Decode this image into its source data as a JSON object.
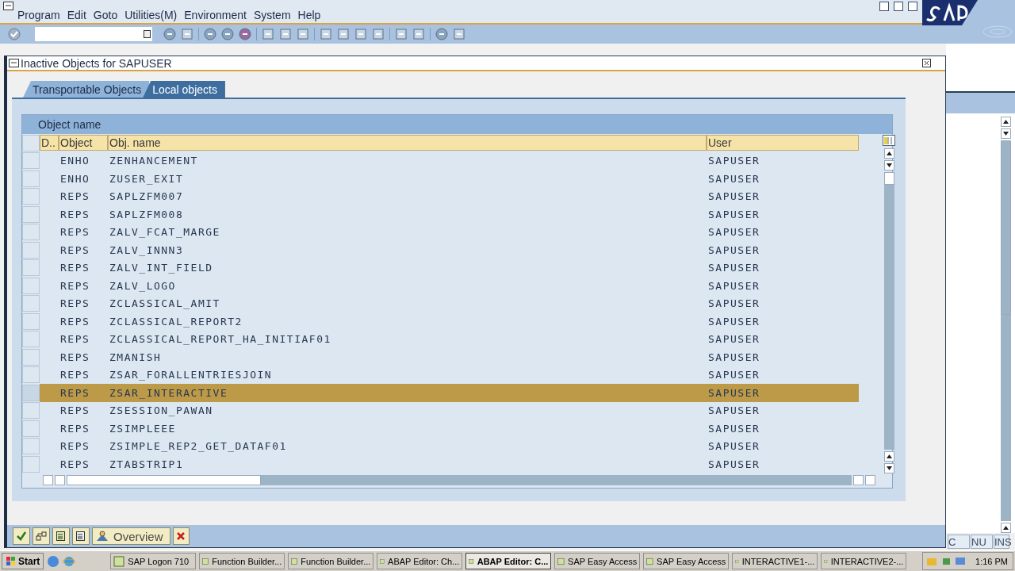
{
  "menu": [
    "Program",
    "Edit",
    "Goto",
    "Utilities(M)",
    "Environment",
    "System",
    "Help"
  ],
  "dialog": {
    "title": "Inactive Objects for SAPUSER",
    "tabs": [
      {
        "label": "Transportable Objects",
        "selected": false
      },
      {
        "label": "Local objects",
        "selected": true
      }
    ],
    "table": {
      "group_header": "Object name",
      "columns": [
        "D..",
        "Object",
        "Obj. name",
        "User"
      ],
      "rows": [
        {
          "object": "ENHO",
          "name": "ZENHANCEMENT",
          "user": "SAPUSER",
          "selected": false
        },
        {
          "object": "ENHO",
          "name": "ZUSER_EXIT",
          "user": "SAPUSER",
          "selected": false
        },
        {
          "object": "REPS",
          "name": "SAPLZFM007",
          "user": "SAPUSER",
          "selected": false
        },
        {
          "object": "REPS",
          "name": "SAPLZFM008",
          "user": "SAPUSER",
          "selected": false
        },
        {
          "object": "REPS",
          "name": "ZALV_FCAT_MARGE",
          "user": "SAPUSER",
          "selected": false
        },
        {
          "object": "REPS",
          "name": "ZALV_INNN3",
          "user": "SAPUSER",
          "selected": false
        },
        {
          "object": "REPS",
          "name": "ZALV_INT_FIELD",
          "user": "SAPUSER",
          "selected": false
        },
        {
          "object": "REPS",
          "name": "ZALV_LOGO",
          "user": "SAPUSER",
          "selected": false
        },
        {
          "object": "REPS",
          "name": "ZCLASSICAL_AMIT",
          "user": "SAPUSER",
          "selected": false
        },
        {
          "object": "REPS",
          "name": "ZCLASSICAL_REPORT2",
          "user": "SAPUSER",
          "selected": false
        },
        {
          "object": "REPS",
          "name": "ZCLASSICAL_REPORT_HA_INITIAF01",
          "user": "SAPUSER",
          "selected": false
        },
        {
          "object": "REPS",
          "name": "ZMANISH",
          "user": "SAPUSER",
          "selected": false
        },
        {
          "object": "REPS",
          "name": "ZSAR_FORALLENTRIESJOIN",
          "user": "SAPUSER",
          "selected": false
        },
        {
          "object": "REPS",
          "name": "ZSAR_INTERACTIVE",
          "user": "SAPUSER",
          "selected": true
        },
        {
          "object": "REPS",
          "name": "ZSESSION_PAWAN",
          "user": "SAPUSER",
          "selected": false
        },
        {
          "object": "REPS",
          "name": "ZSIMPLEEE",
          "user": "SAPUSER",
          "selected": false
        },
        {
          "object": "REPS",
          "name": "ZSIMPLE_REP2_GET_DATAF01",
          "user": "SAPUSER",
          "selected": false
        },
        {
          "object": "REPS",
          "name": "ZTABSTRIP1",
          "user": "SAPUSER",
          "selected": false
        }
      ]
    },
    "overview_button": {
      "label": "Overview"
    }
  },
  "status_fields": [
    "C",
    "NU",
    "INS"
  ],
  "taskbar": {
    "start": "Start",
    "items": [
      {
        "label": "SAP Logon 710",
        "selected": false
      },
      {
        "label": "Function Builder...",
        "selected": false
      },
      {
        "label": "Function Builder...",
        "selected": false
      },
      {
        "label": "ABAP Editor: Ch...",
        "selected": false
      },
      {
        "label": "ABAP Editor: C...",
        "selected": true
      },
      {
        "label": "SAP Easy Access",
        "selected": false
      },
      {
        "label": "SAP Easy Access",
        "selected": false
      },
      {
        "label": "INTERACTIVE1-...",
        "selected": false
      },
      {
        "label": "INTERACTIVE2-...",
        "selected": false
      }
    ],
    "clock": "1:16 PM"
  }
}
